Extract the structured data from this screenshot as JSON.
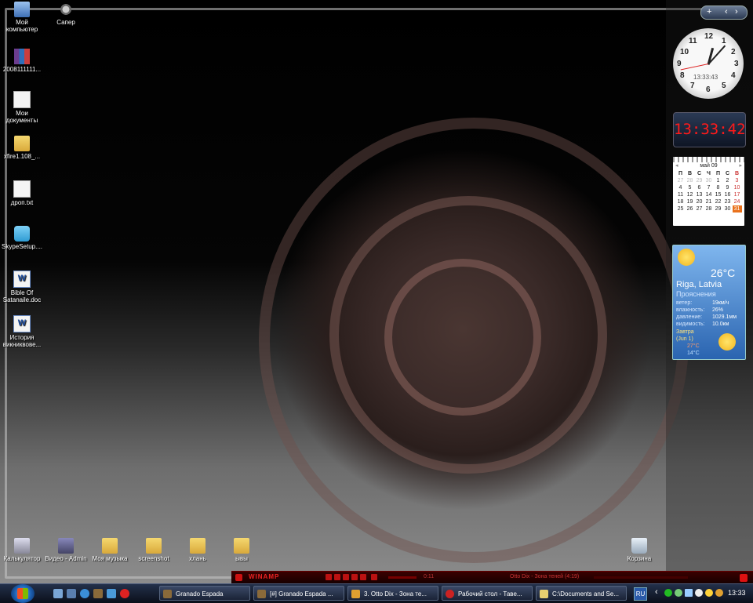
{
  "desktop": {
    "icons_left": [
      {
        "label": "Мой компьютер",
        "icon": "computer-icon"
      },
      {
        "label": "2008111111...",
        "icon": "archive-icon"
      },
      {
        "label": "Мои документы",
        "icon": "documents-icon"
      },
      {
        "label": "xfire1.108_...",
        "icon": "folder-icon"
      },
      {
        "label": "дроп.txt",
        "icon": "text-file-icon"
      },
      {
        "label": "SkypeSetup....",
        "icon": "installer-icon"
      },
      {
        "label": "Bible Of Satanaile.doc",
        "icon": "word-doc-icon"
      },
      {
        "label": "История викниквове...",
        "icon": "word-doc-icon"
      }
    ],
    "icon_saper": {
      "label": "Сапер",
      "icon": "gear-icon"
    },
    "icons_bottom": [
      {
        "label": "Калькулятор",
        "icon": "calculator-icon"
      },
      {
        "label": "Видео - Admin",
        "icon": "video-icon"
      },
      {
        "label": "Моя музыка",
        "icon": "folder-icon"
      },
      {
        "label": "screenshot",
        "icon": "folder-icon"
      },
      {
        "label": "хлань",
        "icon": "folder-icon"
      },
      {
        "label": "ывы",
        "icon": "folder-icon"
      }
    ],
    "recycle_bin": {
      "label": "Корзина",
      "icon": "recycle-bin-icon"
    }
  },
  "sidebar": {
    "controls": {
      "add": "+",
      "prev": "‹",
      "next": "›"
    },
    "analog_clock": {
      "time_text": "13:33:43",
      "numbers": [
        "12",
        "1",
        "2",
        "3",
        "4",
        "5",
        "6",
        "7",
        "8",
        "9",
        "10",
        "11"
      ]
    },
    "digital_clock": {
      "time": "13:33:42"
    },
    "calendar": {
      "month": "май 09",
      "weekdays": [
        "П",
        "В",
        "С",
        "Ч",
        "П",
        "С",
        "В"
      ],
      "weeks": [
        [
          "27",
          "28",
          "29",
          "30",
          "1",
          "2",
          "3"
        ],
        [
          "4",
          "5",
          "6",
          "7",
          "8",
          "9",
          "10"
        ],
        [
          "11",
          "12",
          "13",
          "14",
          "15",
          "16",
          "17"
        ],
        [
          "18",
          "19",
          "20",
          "21",
          "22",
          "23",
          "24"
        ],
        [
          "25",
          "26",
          "27",
          "28",
          "29",
          "30",
          "31"
        ]
      ],
      "today": "31"
    },
    "weather": {
      "temperature": "26°C",
      "city": "Riga, Latvia",
      "condition": "Прояснения",
      "details": [
        {
          "key": "ветер:",
          "value": "19км/ч"
        },
        {
          "key": "влажность:",
          "value": "26%"
        },
        {
          "key": "давление:",
          "value": "1029.1мм"
        },
        {
          "key": "видимость:",
          "value": "10.0км"
        }
      ],
      "tomorrow_label": "Завтра",
      "tomorrow_date": "(Jun 1)",
      "tomorrow_high": "27°C",
      "tomorrow_low": "14°C"
    }
  },
  "winamp": {
    "logo": "WINAMP",
    "time": "0:11",
    "track": "Otto Dix - Зона теней (4:19)"
  },
  "taskbar": {
    "tasks": [
      {
        "label": "Granado Espada",
        "color": "#8a6a3a"
      },
      {
        "label": "[#] Granado Espada ...",
        "color": "#8a6a3a"
      },
      {
        "label": "3. Otto Dix - Зона те...",
        "color": "#e0a030"
      },
      {
        "label": "Рабочий стол - Таве...",
        "color": "#cc2222"
      },
      {
        "label": "C:\\Documents and Se...",
        "color": "#e8d070"
      }
    ],
    "language": "RU",
    "clock": "13:33"
  }
}
